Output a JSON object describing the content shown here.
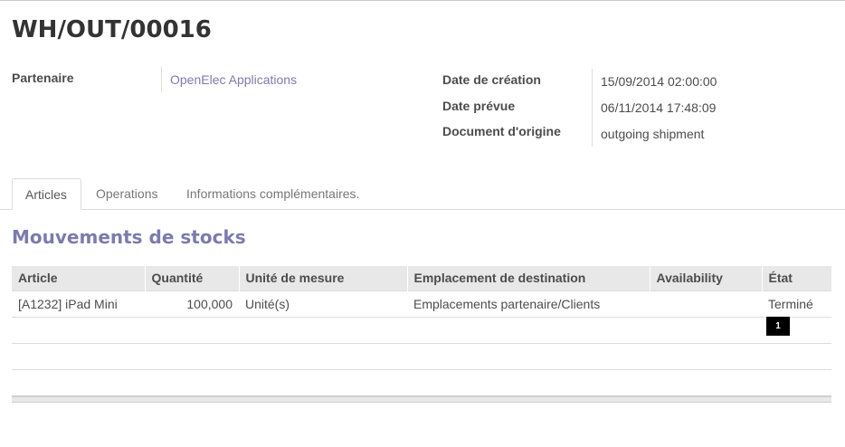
{
  "record": {
    "title": "WH/OUT/00016"
  },
  "fields": {
    "partner_label": "Partenaire",
    "partner_value": "OpenElec Applications",
    "creation_label": "Date de création",
    "creation_value": "15/09/2014 02:00:00",
    "scheduled_label": "Date prévue",
    "scheduled_value": "06/11/2014 17:48:09",
    "origin_label": "Document d'origine",
    "origin_value": "outgoing shipment"
  },
  "tabs": [
    {
      "label": "Articles",
      "active": true
    },
    {
      "label": "Operations",
      "active": false
    },
    {
      "label": "Informations complémentaires.",
      "active": false
    }
  ],
  "section": {
    "title": "Mouvements de stocks"
  },
  "table": {
    "headers": [
      "Article",
      "Quantité",
      "Unité de mesure",
      "Emplacement de destination",
      "Availability",
      "État"
    ],
    "rows": [
      [
        "[A1232] iPad Mini",
        "100,000",
        "Unité(s)",
        "Emplacements partenaire/Clients",
        "",
        "Terminé"
      ]
    ]
  },
  "badge": {
    "text": "1"
  }
}
